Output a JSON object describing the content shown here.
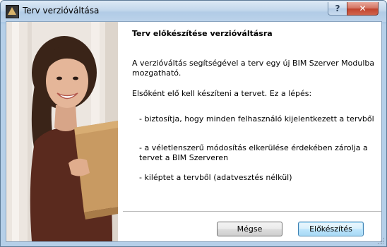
{
  "window": {
    "title": "Terv verzióváltása",
    "help_label": "?",
    "close_label": "✕"
  },
  "content": {
    "heading": "Terv előkészítése verzióváltásra",
    "intro": "A verzióváltás segítségével a terv egy új BIM Szerver Modulba mozgatható.",
    "step_intro": "Elsőként elő kell készíteni a tervet. Ez a lépés:",
    "bullets": [
      "- biztosítja, hogy minden felhasználó kijelentkezett a tervből",
      "- a véletlenszerű módosítás elkerülése érdekében zárolja a tervet a BIM Szerveren",
      "- kiléptet a tervből (adatvesztés nélkül)"
    ]
  },
  "buttons": {
    "cancel_label": "Mégse",
    "prepare_label": "Előkészítés"
  },
  "icons": {
    "app": "app-logo-icon",
    "help": "help-icon",
    "close": "close-icon"
  },
  "colors": {
    "close_button": "#c1452f",
    "default_button_border": "#3c7fb1",
    "frame": "#b1cbe6"
  }
}
